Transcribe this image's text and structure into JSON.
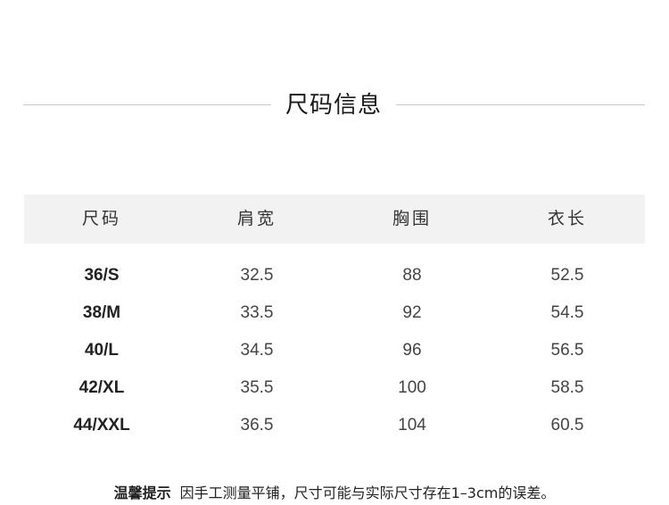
{
  "title": "尺码信息",
  "table": {
    "headers": [
      "尺码",
      "肩宽",
      "胸围",
      "衣长"
    ],
    "rows": [
      [
        "36/S",
        "32.5",
        "88",
        "52.5"
      ],
      [
        "38/M",
        "33.5",
        "92",
        "54.5"
      ],
      [
        "40/L",
        "34.5",
        "96",
        "56.5"
      ],
      [
        "42/XL",
        "35.5",
        "100",
        "58.5"
      ],
      [
        "44/XXL",
        "36.5",
        "104",
        "60.5"
      ]
    ]
  },
  "tip": {
    "label": "温馨提示",
    "text": "因手工测量平铺，尺寸可能与实际尺寸存在1–3cm的误差。"
  }
}
